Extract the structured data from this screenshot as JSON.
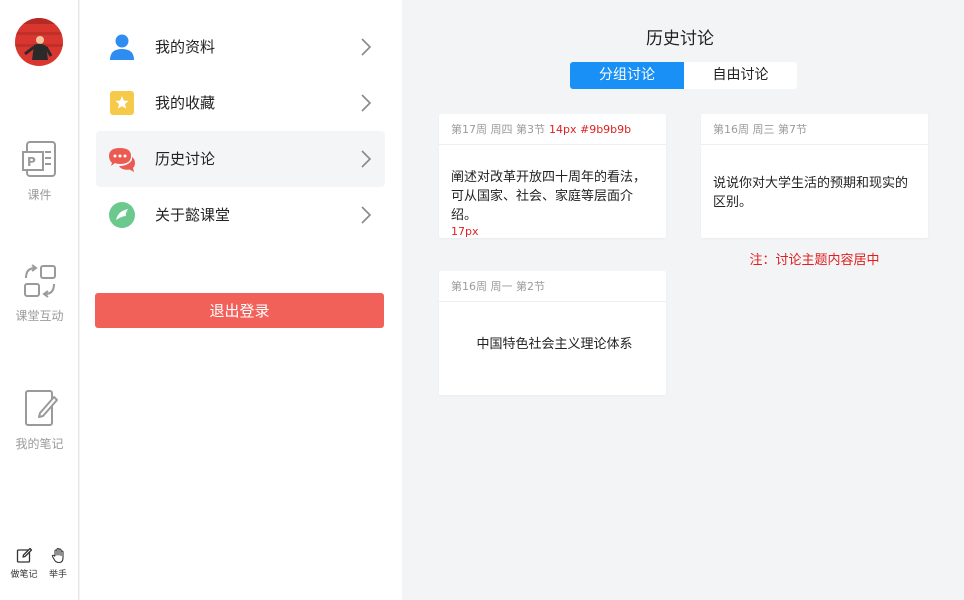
{
  "rail": {
    "items": [
      {
        "label": "课件"
      },
      {
        "label": "课堂互动"
      },
      {
        "label": "我的笔记"
      }
    ],
    "bottom": [
      {
        "label": "做笔记"
      },
      {
        "label": "举手"
      }
    ]
  },
  "menu": {
    "items": [
      {
        "label": "我的资料"
      },
      {
        "label": "我的收藏"
      },
      {
        "label": "历史讨论"
      },
      {
        "label": "关于懿课堂"
      }
    ],
    "logout_label": "退出登录"
  },
  "main": {
    "title": "历史讨论",
    "tabs": [
      {
        "label": "分组讨论",
        "selected": true
      },
      {
        "label": "自由讨论",
        "selected": false
      }
    ],
    "cards": [
      {
        "meta": "第17周 周四 第3节",
        "meta_annotation": "14px  #9b9b9b",
        "text": "阐述对改革开放四十周年的看法，可从国家、社会、家庭等层面介绍。",
        "text_annotation": "17px"
      },
      {
        "meta": "第16周 周三 第7节",
        "text": "说说你对大学生活的预期和现实的区别。"
      },
      {
        "meta": "第16周 周一 第2节",
        "text": "中国特色社会主义理论体系"
      }
    ],
    "note": "注：讨论主题内容居中"
  },
  "colors": {
    "accent": "#1890f5",
    "logout": "#f26159",
    "annotation": "#e02020",
    "meta_text": "#9b9b9b"
  }
}
